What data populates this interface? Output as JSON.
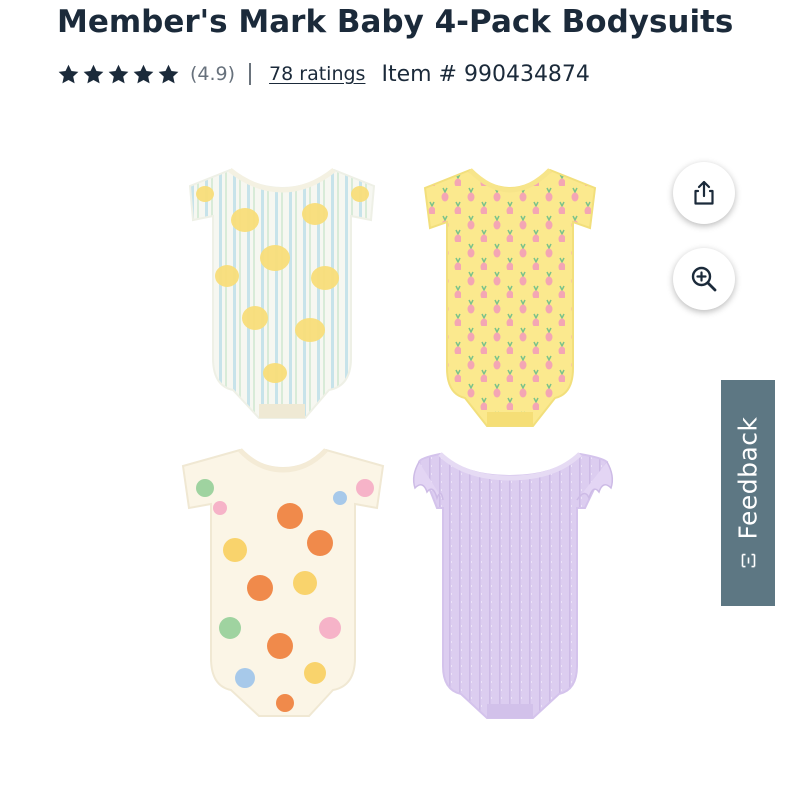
{
  "product": {
    "title": "Member's Mark Baby 4-Pack Bodysuits",
    "rating_value": 4.9,
    "rating_display": "(4.9)",
    "ratings_link": "78 ratings",
    "item_number": "Item # 990434874",
    "image_alt": "Four baby bodysuits: striped lemon print, yellow pineapple print, fruit print, and lavender ribbed with flutter sleeves"
  },
  "actions": {
    "share_icon": "share-icon",
    "zoom_icon": "zoom-in-icon"
  },
  "feedback": {
    "label": "Feedback",
    "icon": "feedback-icon"
  },
  "colors": {
    "title": "#1b2a3a",
    "star": "#1b2a3a",
    "feedback_bg": "#5d7783"
  }
}
